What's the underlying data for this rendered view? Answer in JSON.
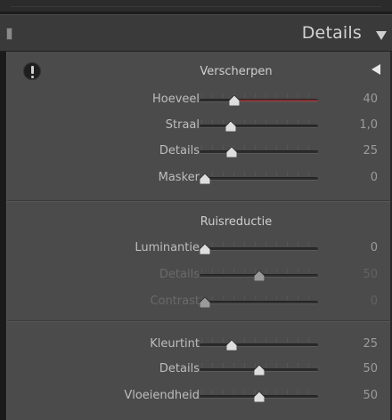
{
  "header": {
    "title": "Details"
  },
  "sharpen": {
    "title": "Verscherpen",
    "rows": [
      {
        "label": "Hoeveel",
        "value": "40",
        "fraction": 0.27,
        "red_from": 0.27,
        "dim": false
      },
      {
        "label": "Straal",
        "value": "1,0",
        "fraction": 0.24,
        "dim": false
      },
      {
        "label": "Details",
        "value": "25",
        "fraction": 0.25,
        "dim": false
      },
      {
        "label": "Masker",
        "value": "0",
        "fraction": 0.0,
        "dim": false
      }
    ]
  },
  "noise": {
    "title": "Ruisreductie",
    "rows": [
      {
        "label": "Luminantie",
        "value": "0",
        "fraction": 0.0,
        "dim": false
      },
      {
        "label": "Details",
        "value": "50",
        "fraction": 0.5,
        "dim": true
      },
      {
        "label": "Contrast",
        "value": "0",
        "fraction": 0.0,
        "dim": true
      }
    ]
  },
  "color": {
    "rows": [
      {
        "label": "Kleurtint",
        "value": "25",
        "fraction": 0.25,
        "dim": false
      },
      {
        "label": "Details",
        "value": "50",
        "fraction": 0.5,
        "dim": false
      },
      {
        "label": "Vloeiendheid",
        "value": "50",
        "fraction": 0.5,
        "dim": false
      }
    ]
  },
  "icons": {
    "panel_toggle": "panel-toggle-icon",
    "collapse": "collapse-triangle-icon",
    "warning": "warning-icon",
    "section_collapse": "section-collapse-icon"
  },
  "colors": {
    "panel_bg": "#4b4b4b",
    "header_bg": "#3a3a3a",
    "red_track": "#8a2f2f"
  }
}
